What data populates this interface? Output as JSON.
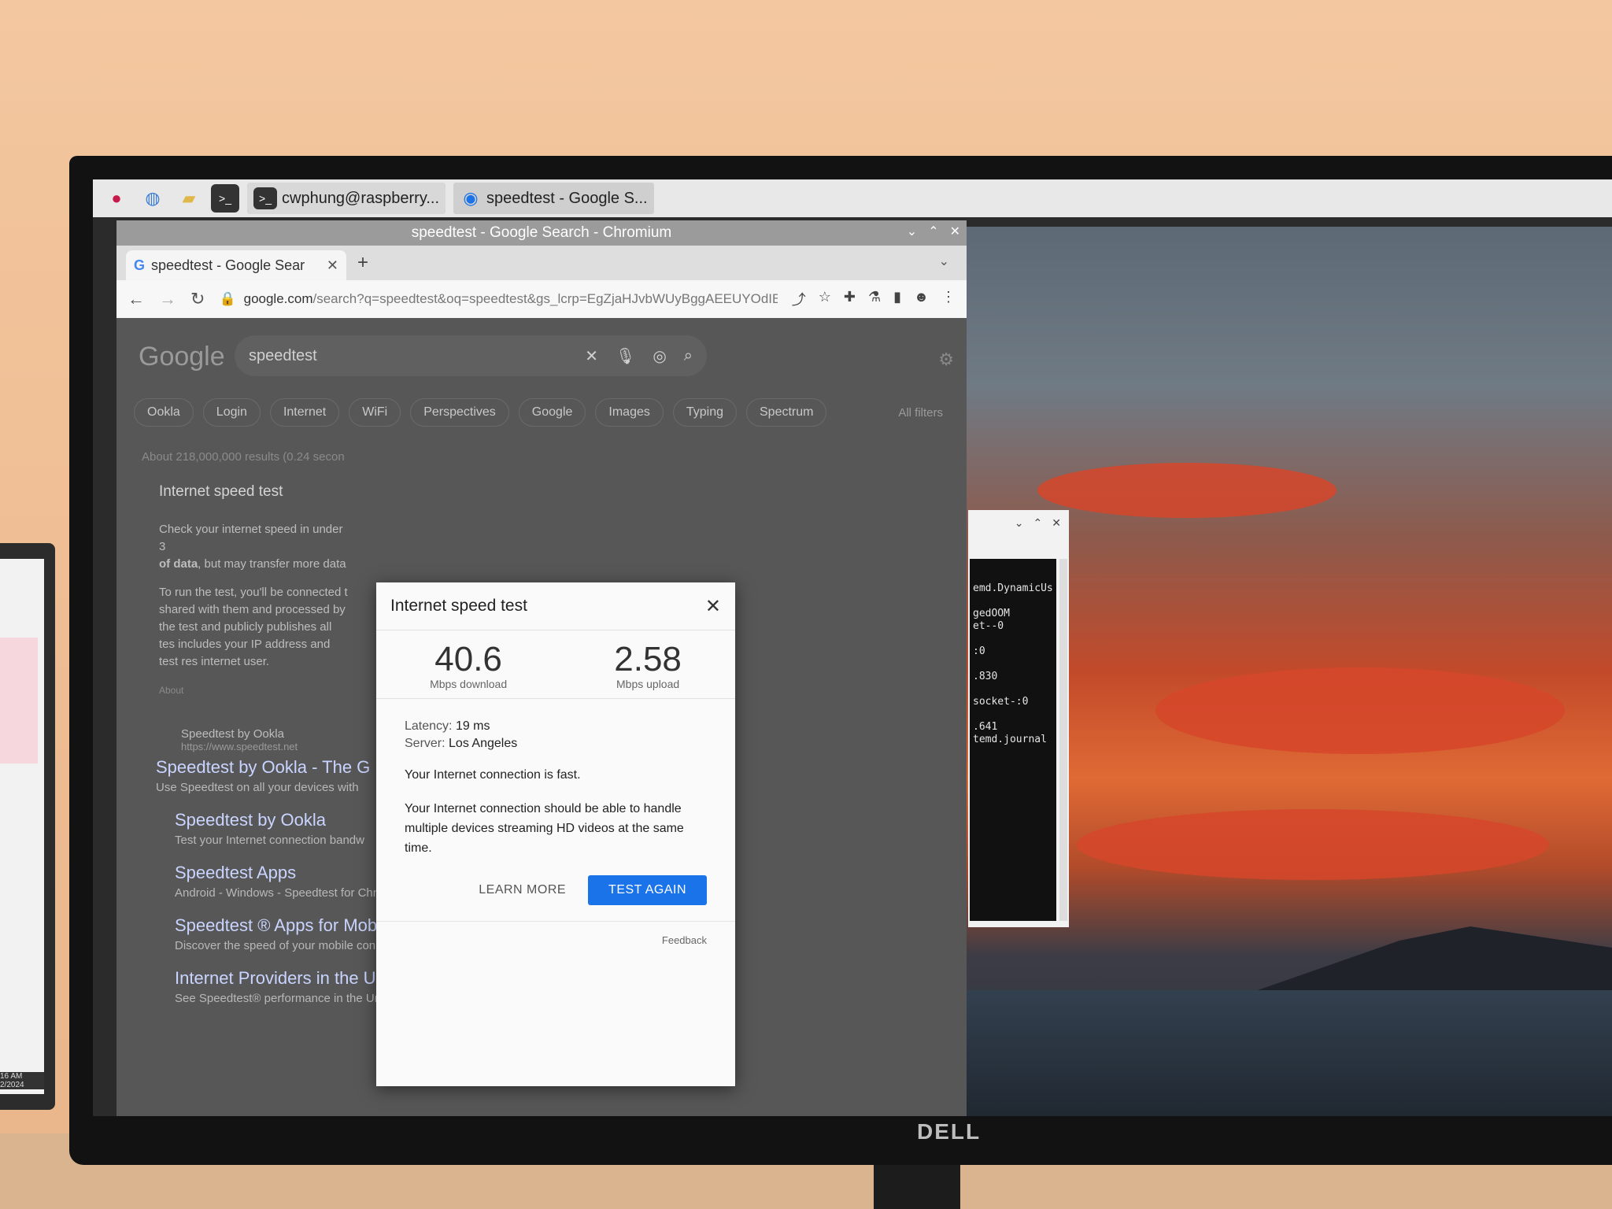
{
  "taskbar": {
    "tasks": [
      {
        "label": "cwphung@raspberry..."
      },
      {
        "label": "speedtest - Google S..."
      }
    ]
  },
  "browser": {
    "window_title": "speedtest - Google Search - Chromium",
    "tab_title": "speedtest - Google Sear",
    "url_domain": "google.com",
    "url_path": "/search?q=speedtest&oq=speedtest&gs_lcrp=EgZjaHJvbWUyBggAEEUYOdIB..."
  },
  "google": {
    "logo": "Google",
    "query": "speedtest",
    "chips": [
      "Ookla",
      "Login",
      "Internet",
      "WiFi",
      "Perspectives",
      "Google",
      "Images",
      "Typing",
      "Spectrum"
    ],
    "all_filters": "All filters",
    "result_stats": "About 218,000,000 results (0.24 secon",
    "card_title": "Internet speed test",
    "card_line1": "Check your internet speed in under 3",
    "card_line2_bold": "of data",
    "card_line2_rest": ", but may transfer more data",
    "card_para": "To run the test, you'll be connected t shared with them and processed by the test and publicly publishes all tes includes your IP address and test res internet user.",
    "card_about": "About",
    "results": [
      {
        "site": "Speedtest by Ookla",
        "url": "https://www.speedtest.net",
        "title": "Speedtest by Ookla - The G",
        "desc": "Use Speedtest on all your devices with"
      },
      {
        "title": "Speedtest by Ookla",
        "desc": "Test your Internet connection bandw"
      },
      {
        "title": "Speedtest Apps",
        "desc": "Android - Windows - Speedtest for Chrome - iOS - Speedtest CLI"
      },
      {
        "title": "Speedtest ® Apps for Mobile",
        "desc": "Discover the speed of your mobile connection with easy, one-tap ..."
      },
      {
        "title": "Internet Providers in the United ...",
        "desc": "See Speedtest® performance in the United States. Click below to ..."
      }
    ]
  },
  "dialog": {
    "title": "Internet speed test",
    "download_value": "40.6",
    "download_unit": "Mbps download",
    "upload_value": "2.58",
    "upload_unit": "Mbps upload",
    "latency_label": "Latency:",
    "latency_value": "19 ms",
    "server_label": "Server:",
    "server_value": "Los Angeles",
    "status": "Your Internet connection is fast.",
    "detail": "Your Internet connection should be able to handle multiple devices streaming HD videos at the same time.",
    "learn_more": "LEARN MORE",
    "test_again": "TEST AGAIN",
    "feedback": "Feedback"
  },
  "terminal": {
    "lines": [
      "emd.DynamicUs",
      "gedOOM\net--0",
      ":0",
      ".830",
      "socket-:0",
      ".641\ntemd.journal"
    ]
  },
  "monitor": {
    "brand": "DELL"
  },
  "laptop": {
    "time": "16 AM\n2/2024"
  }
}
